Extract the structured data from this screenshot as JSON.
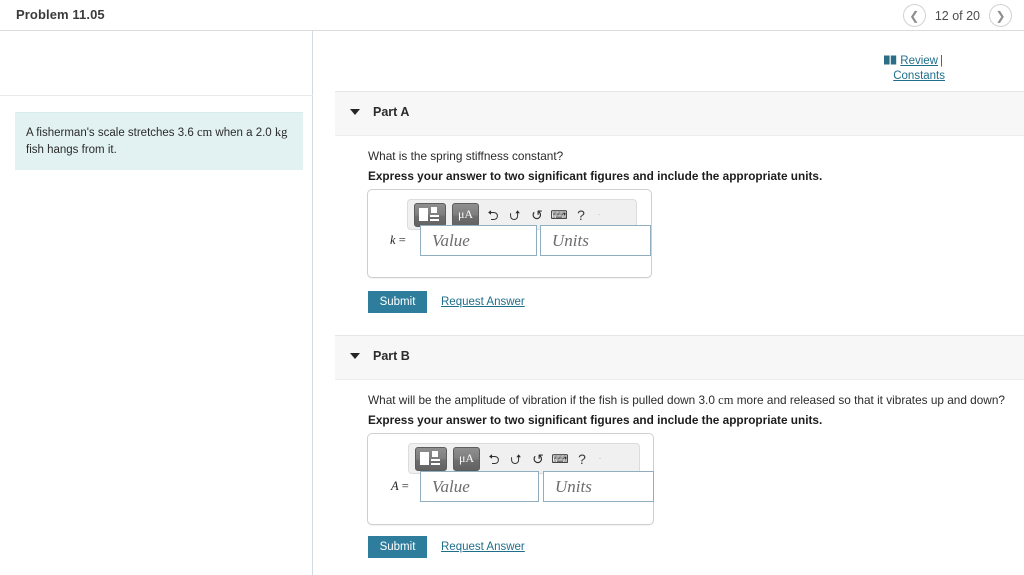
{
  "header": {
    "problem_title": "Problem 11.05",
    "pager": {
      "prev_icon": "chevron-left-icon",
      "next_icon": "chevron-right-icon",
      "label": "12 of 20",
      "current": 12,
      "total": 20
    }
  },
  "sidebar": {
    "problem_statement_parts": {
      "text_1": "A fisherman's scale stretches 3.6 ",
      "unit_1": "cm",
      "text_2": " when a 2.0 ",
      "unit_2": "kg",
      "text_3": " fish hangs from it."
    },
    "problem_statement_full": "A fisherman's scale stretches 3.6 cm when a 2.0 kg fish hangs from it.",
    "background_color": "#e2f1f1"
  },
  "toolbar_links": {
    "book_icon": "book-icon",
    "review_label": "Review",
    "separator": "|",
    "constants_label": "Constants",
    "link_color": "#1f6f8b"
  },
  "math_toolbar": {
    "template_button": "math-template-icon",
    "units_button": "μA",
    "undo_icon": "⮌",
    "redo_icon": "⮍",
    "reset_icon": "↺",
    "keyboard_icon": "⌨",
    "help_icon": "?",
    "overflow_icon": "·"
  },
  "parts": [
    {
      "id": "part-a",
      "caret_icon": "caret-down-icon",
      "title": "Part A",
      "question": "What is the spring stiffness constant?",
      "instruction": "Express your answer to two significant figures and include the appropriate units.",
      "variable": "k",
      "equals": "=",
      "value_placeholder": "Value",
      "units_placeholder": "Units",
      "value": "",
      "units": "",
      "submit_label": "Submit",
      "request_answer_label": "Request Answer"
    },
    {
      "id": "part-b",
      "caret_icon": "caret-down-icon",
      "title": "Part B",
      "question_parts": {
        "text_1": "What will be the amplitude of vibration if the fish is pulled down 3.0 ",
        "unit_1": "cm",
        "text_2": " more and released so that it vibrates up and down?"
      },
      "question": "What will be the amplitude of vibration if the fish is pulled down 3.0 cm more and released so that it vibrates up and down?",
      "instruction": "Express your answer to two significant figures and include the appropriate units.",
      "variable": "A",
      "equals": "=",
      "value_placeholder": "Value",
      "units_placeholder": "Units",
      "value": "",
      "units": "",
      "submit_label": "Submit",
      "request_answer_label": "Request Answer"
    }
  ],
  "colors": {
    "accent": "#2e7d9c",
    "link": "#1f6f8b",
    "band": "#f7f7f7",
    "statement_bg": "#e2f1f1",
    "field_border": "#8fafc0"
  }
}
